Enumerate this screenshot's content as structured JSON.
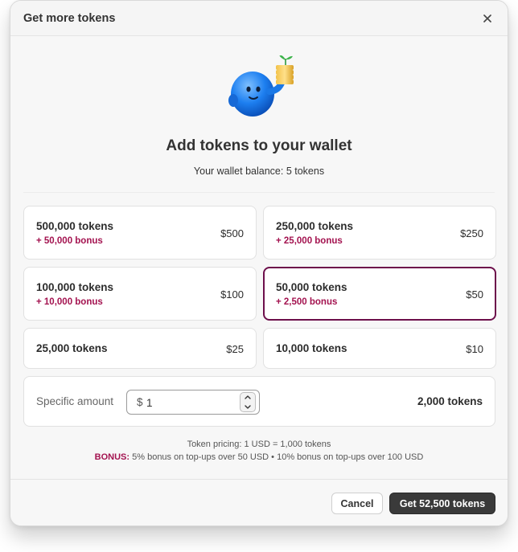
{
  "dialog": {
    "title": "Get more tokens",
    "close_icon": "close-icon"
  },
  "mascot": {
    "icon": "blue-mascot-holding-coins"
  },
  "heading": "Add tokens to your wallet",
  "balance": "Your wallet balance: 5 tokens",
  "options": [
    {
      "tokens": "500,000 tokens",
      "bonus": "+ 50,000 bonus",
      "price": "$500",
      "selected": false
    },
    {
      "tokens": "250,000 tokens",
      "bonus": "+ 25,000 bonus",
      "price": "$250",
      "selected": false
    },
    {
      "tokens": "100,000 tokens",
      "bonus": "+ 10,000 bonus",
      "price": "$100",
      "selected": false
    },
    {
      "tokens": "50,000 tokens",
      "bonus": "+ 2,500 bonus",
      "price": "$50",
      "selected": true
    },
    {
      "tokens": "25,000 tokens",
      "price": "$25",
      "selected": false
    },
    {
      "tokens": "10,000 tokens",
      "price": "$10",
      "selected": false
    }
  ],
  "specific": {
    "label": "Specific amount",
    "currency": "$",
    "value": "1",
    "result": "2,000 tokens"
  },
  "pricing": {
    "line1": "Token pricing: 1 USD = 1,000 tokens",
    "bonus_label": "BONUS:",
    "bonus_text": "5% bonus on top-ups over 50 USD • 10% bonus on top-ups over 100 USD"
  },
  "footer": {
    "cancel": "Cancel",
    "confirm": "Get 52,500 tokens"
  },
  "colors": {
    "accent": "#6d0f4b",
    "bonus": "#a3124f",
    "primary_button": "#3a3a3a"
  }
}
